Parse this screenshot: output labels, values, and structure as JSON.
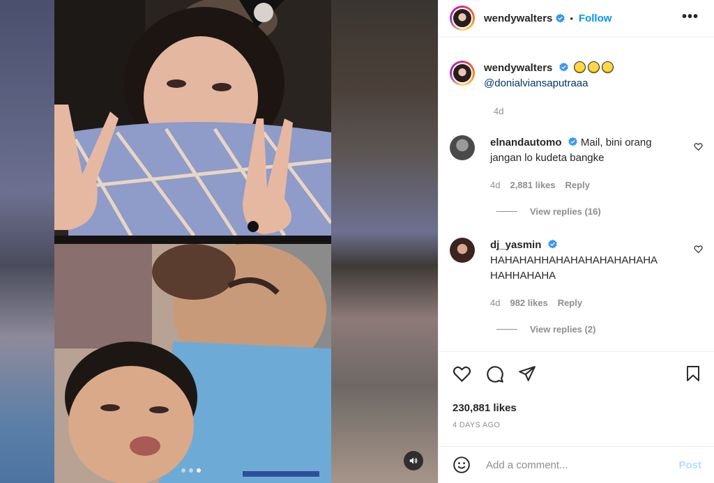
{
  "header": {
    "username": "wendywalters",
    "separator": "•",
    "follow_label": "Follow",
    "more_label": "•••"
  },
  "caption": {
    "username": "wendywalters",
    "emojis": [
      "rolling-on-floor-laughing",
      "rolling-on-floor-laughing",
      "rolling-on-floor-laughing"
    ],
    "mention": "@donialviansaputraaa",
    "time": "4d"
  },
  "comments": [
    {
      "username": "elnandautomo",
      "text": "Mail, bini orang jangan lo kudeta bangke",
      "time": "4d",
      "likes": "2,881 likes",
      "reply_label": "Reply",
      "view_replies": "View replies (16)"
    },
    {
      "username": "dj_yasmin",
      "text": "HAHAHAHHAHAHAHAHAHAHAHA HAHHAHAHA",
      "time": "4d",
      "likes": "982 likes",
      "reply_label": "Reply",
      "view_replies": "View replies (2)"
    }
  ],
  "actions": {
    "likes": "230,881 likes",
    "date": "4 DAYS AGO"
  },
  "comment_box": {
    "placeholder": "Add a comment...",
    "post_label": "Post"
  },
  "media": {
    "carousel_dots": 3,
    "active_dot": 2,
    "sound_icon": "speaker-icon"
  },
  "colors": {
    "accent": "#0095f6",
    "verified": "#3897f0",
    "muted": "#8e8e8e",
    "post_disabled": "#b2dffc"
  }
}
